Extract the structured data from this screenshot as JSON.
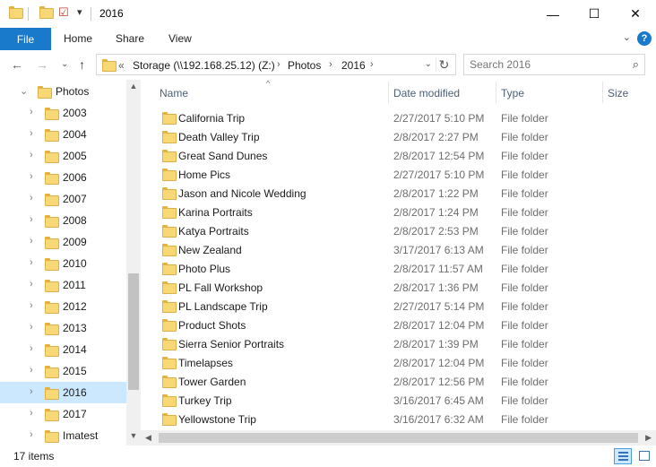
{
  "window": {
    "title": "2016",
    "minimize_glyph": "—",
    "maximize_glyph": "☐",
    "close_glyph": "✕"
  },
  "quick_access": {
    "dropdown_glyph": "▾",
    "properties_glyph": "☑"
  },
  "ribbon": {
    "file": "File",
    "tabs": [
      "Home",
      "Share",
      "View"
    ],
    "expand_glyph": "⌄",
    "help_glyph": "?"
  },
  "nav": {
    "back_glyph": "←",
    "forward_glyph": "→",
    "recent_glyph": "⌄",
    "up_glyph": "↑",
    "overflow": "«",
    "breadcrumb": [
      "Storage (\\\\192.168.25.12) (Z:)",
      "Photos",
      "2016"
    ],
    "crumb_sep": "›",
    "dropdown_glyph": "⌄",
    "refresh_glyph": "↻"
  },
  "search": {
    "placeholder": "Search 2016",
    "icon_glyph": "⌕"
  },
  "tree": {
    "root": "Photos",
    "chevron_expanded": "⌄",
    "chevron_collapsed": "›",
    "items": [
      "2003",
      "2004",
      "2005",
      "2006",
      "2007",
      "2008",
      "2009",
      "2010",
      "2011",
      "2012",
      "2013",
      "2014",
      "2015",
      "2016",
      "2017",
      "Imatest"
    ],
    "selected": "2016"
  },
  "columns": {
    "name": "Name",
    "date": "Date modified",
    "type": "Type",
    "size": "Size",
    "sort_glyph": "^"
  },
  "files": [
    {
      "name": "California Trip",
      "date": "2/27/2017 5:10 PM",
      "type": "File folder"
    },
    {
      "name": "Death Valley Trip",
      "date": "2/8/2017 2:27 PM",
      "type": "File folder"
    },
    {
      "name": "Great Sand Dunes",
      "date": "2/8/2017 12:54 PM",
      "type": "File folder"
    },
    {
      "name": "Home Pics",
      "date": "2/27/2017 5:10 PM",
      "type": "File folder"
    },
    {
      "name": "Jason and Nicole Wedding",
      "date": "2/8/2017 1:22 PM",
      "type": "File folder"
    },
    {
      "name": "Karina Portraits",
      "date": "2/8/2017 1:24 PM",
      "type": "File folder"
    },
    {
      "name": "Katya Portraits",
      "date": "2/8/2017 2:53 PM",
      "type": "File folder"
    },
    {
      "name": "New Zealand",
      "date": "3/17/2017 6:13 AM",
      "type": "File folder"
    },
    {
      "name": "Photo Plus",
      "date": "2/8/2017 11:57 AM",
      "type": "File folder"
    },
    {
      "name": "PL Fall Workshop",
      "date": "2/8/2017 1:36 PM",
      "type": "File folder"
    },
    {
      "name": "PL Landscape Trip",
      "date": "2/27/2017 5:14 PM",
      "type": "File folder"
    },
    {
      "name": "Product Shots",
      "date": "2/8/2017 12:04 PM",
      "type": "File folder"
    },
    {
      "name": "Sierra Senior Portraits",
      "date": "2/8/2017 1:39 PM",
      "type": "File folder"
    },
    {
      "name": "Timelapses",
      "date": "2/8/2017 12:04 PM",
      "type": "File folder"
    },
    {
      "name": "Tower Garden",
      "date": "2/8/2017 12:56 PM",
      "type": "File folder"
    },
    {
      "name": "Turkey Trip",
      "date": "3/16/2017 6:45 AM",
      "type": "File folder"
    },
    {
      "name": "Yellowstone Trip",
      "date": "3/16/2017 6:32 AM",
      "type": "File folder"
    }
  ],
  "scroll": {
    "up_glyph": "▲",
    "down_glyph": "▼",
    "left_glyph": "◀",
    "right_glyph": "▶"
  },
  "status": {
    "item_count": "17 items"
  },
  "colors": {
    "accent": "#1979ca",
    "selection": "#cce8ff",
    "folder": "#f8d775"
  },
  "icons": {
    "folder": "folder-icon",
    "search": "search-icon",
    "refresh": "refresh-icon",
    "help": "help-icon"
  }
}
